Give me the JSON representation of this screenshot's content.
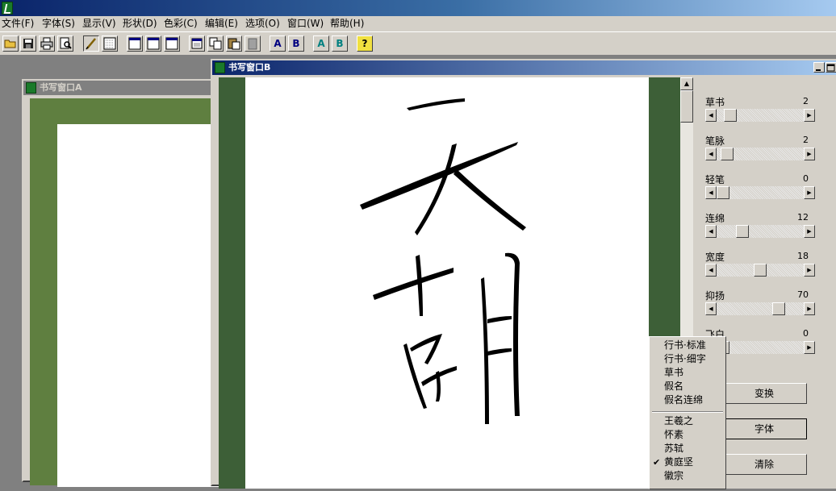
{
  "menubar": {
    "items": [
      "文件(F)",
      "字体(S)",
      "显示(V)",
      "形状(D)",
      "色彩(C)",
      "编辑(E)",
      "选项(O)",
      "窗口(W)",
      "帮助(H)"
    ]
  },
  "toolbar": {
    "buttons": [
      {
        "name": "open-icon"
      },
      {
        "name": "save-icon"
      },
      {
        "name": "print-icon"
      },
      {
        "name": "print-preview-icon"
      },
      {
        "name": "pen-icon"
      },
      {
        "name": "grid-icon"
      },
      {
        "name": "window-1-icon"
      },
      {
        "name": "window-2-icon"
      },
      {
        "name": "window-3-icon"
      },
      {
        "name": "cut-icon"
      },
      {
        "name": "copy-icon"
      },
      {
        "name": "paste-icon"
      },
      {
        "name": "delete-icon"
      },
      {
        "name": "font-a-icon",
        "label": "A"
      },
      {
        "name": "font-b-icon",
        "label": "B"
      },
      {
        "name": "color-a-icon",
        "label": "A"
      },
      {
        "name": "color-b-icon",
        "label": "B"
      },
      {
        "name": "help-icon",
        "label": "?"
      }
    ]
  },
  "windowA": {
    "title": "书写窗口A"
  },
  "windowB": {
    "title": "书写窗口B"
  },
  "calligraphy": {
    "characters": "天朝"
  },
  "panel": {
    "sliders": [
      {
        "label": "草书",
        "value": "2",
        "level": 0.1
      },
      {
        "label": "笔脉",
        "value": "2",
        "level": 0.05
      },
      {
        "label": "轻笔",
        "value": "0",
        "level": 0.0
      },
      {
        "label": "连绵",
        "value": "12",
        "level": 0.26
      },
      {
        "label": "宽度",
        "value": "18",
        "level": 0.5
      },
      {
        "label": "抑扬",
        "value": "70",
        "level": 0.75
      },
      {
        "label": "飞白",
        "value": "0",
        "level": 0.0
      }
    ],
    "buttons": {
      "transform": "变换",
      "font": "字体",
      "clear": "清除"
    }
  },
  "context_menu": {
    "group1": [
      "行书·标准",
      "行书·细字",
      "草书",
      "假名",
      "假名连绵"
    ],
    "group2": [
      "王羲之",
      "怀素",
      "苏轼",
      "黄庭坚",
      "徽宗"
    ],
    "checked": "黄庭坚"
  },
  "colors": {
    "title_active": "#0a246a",
    "canvas_green": "#3d5f37",
    "canvas_green_light": "#5f7f40"
  }
}
